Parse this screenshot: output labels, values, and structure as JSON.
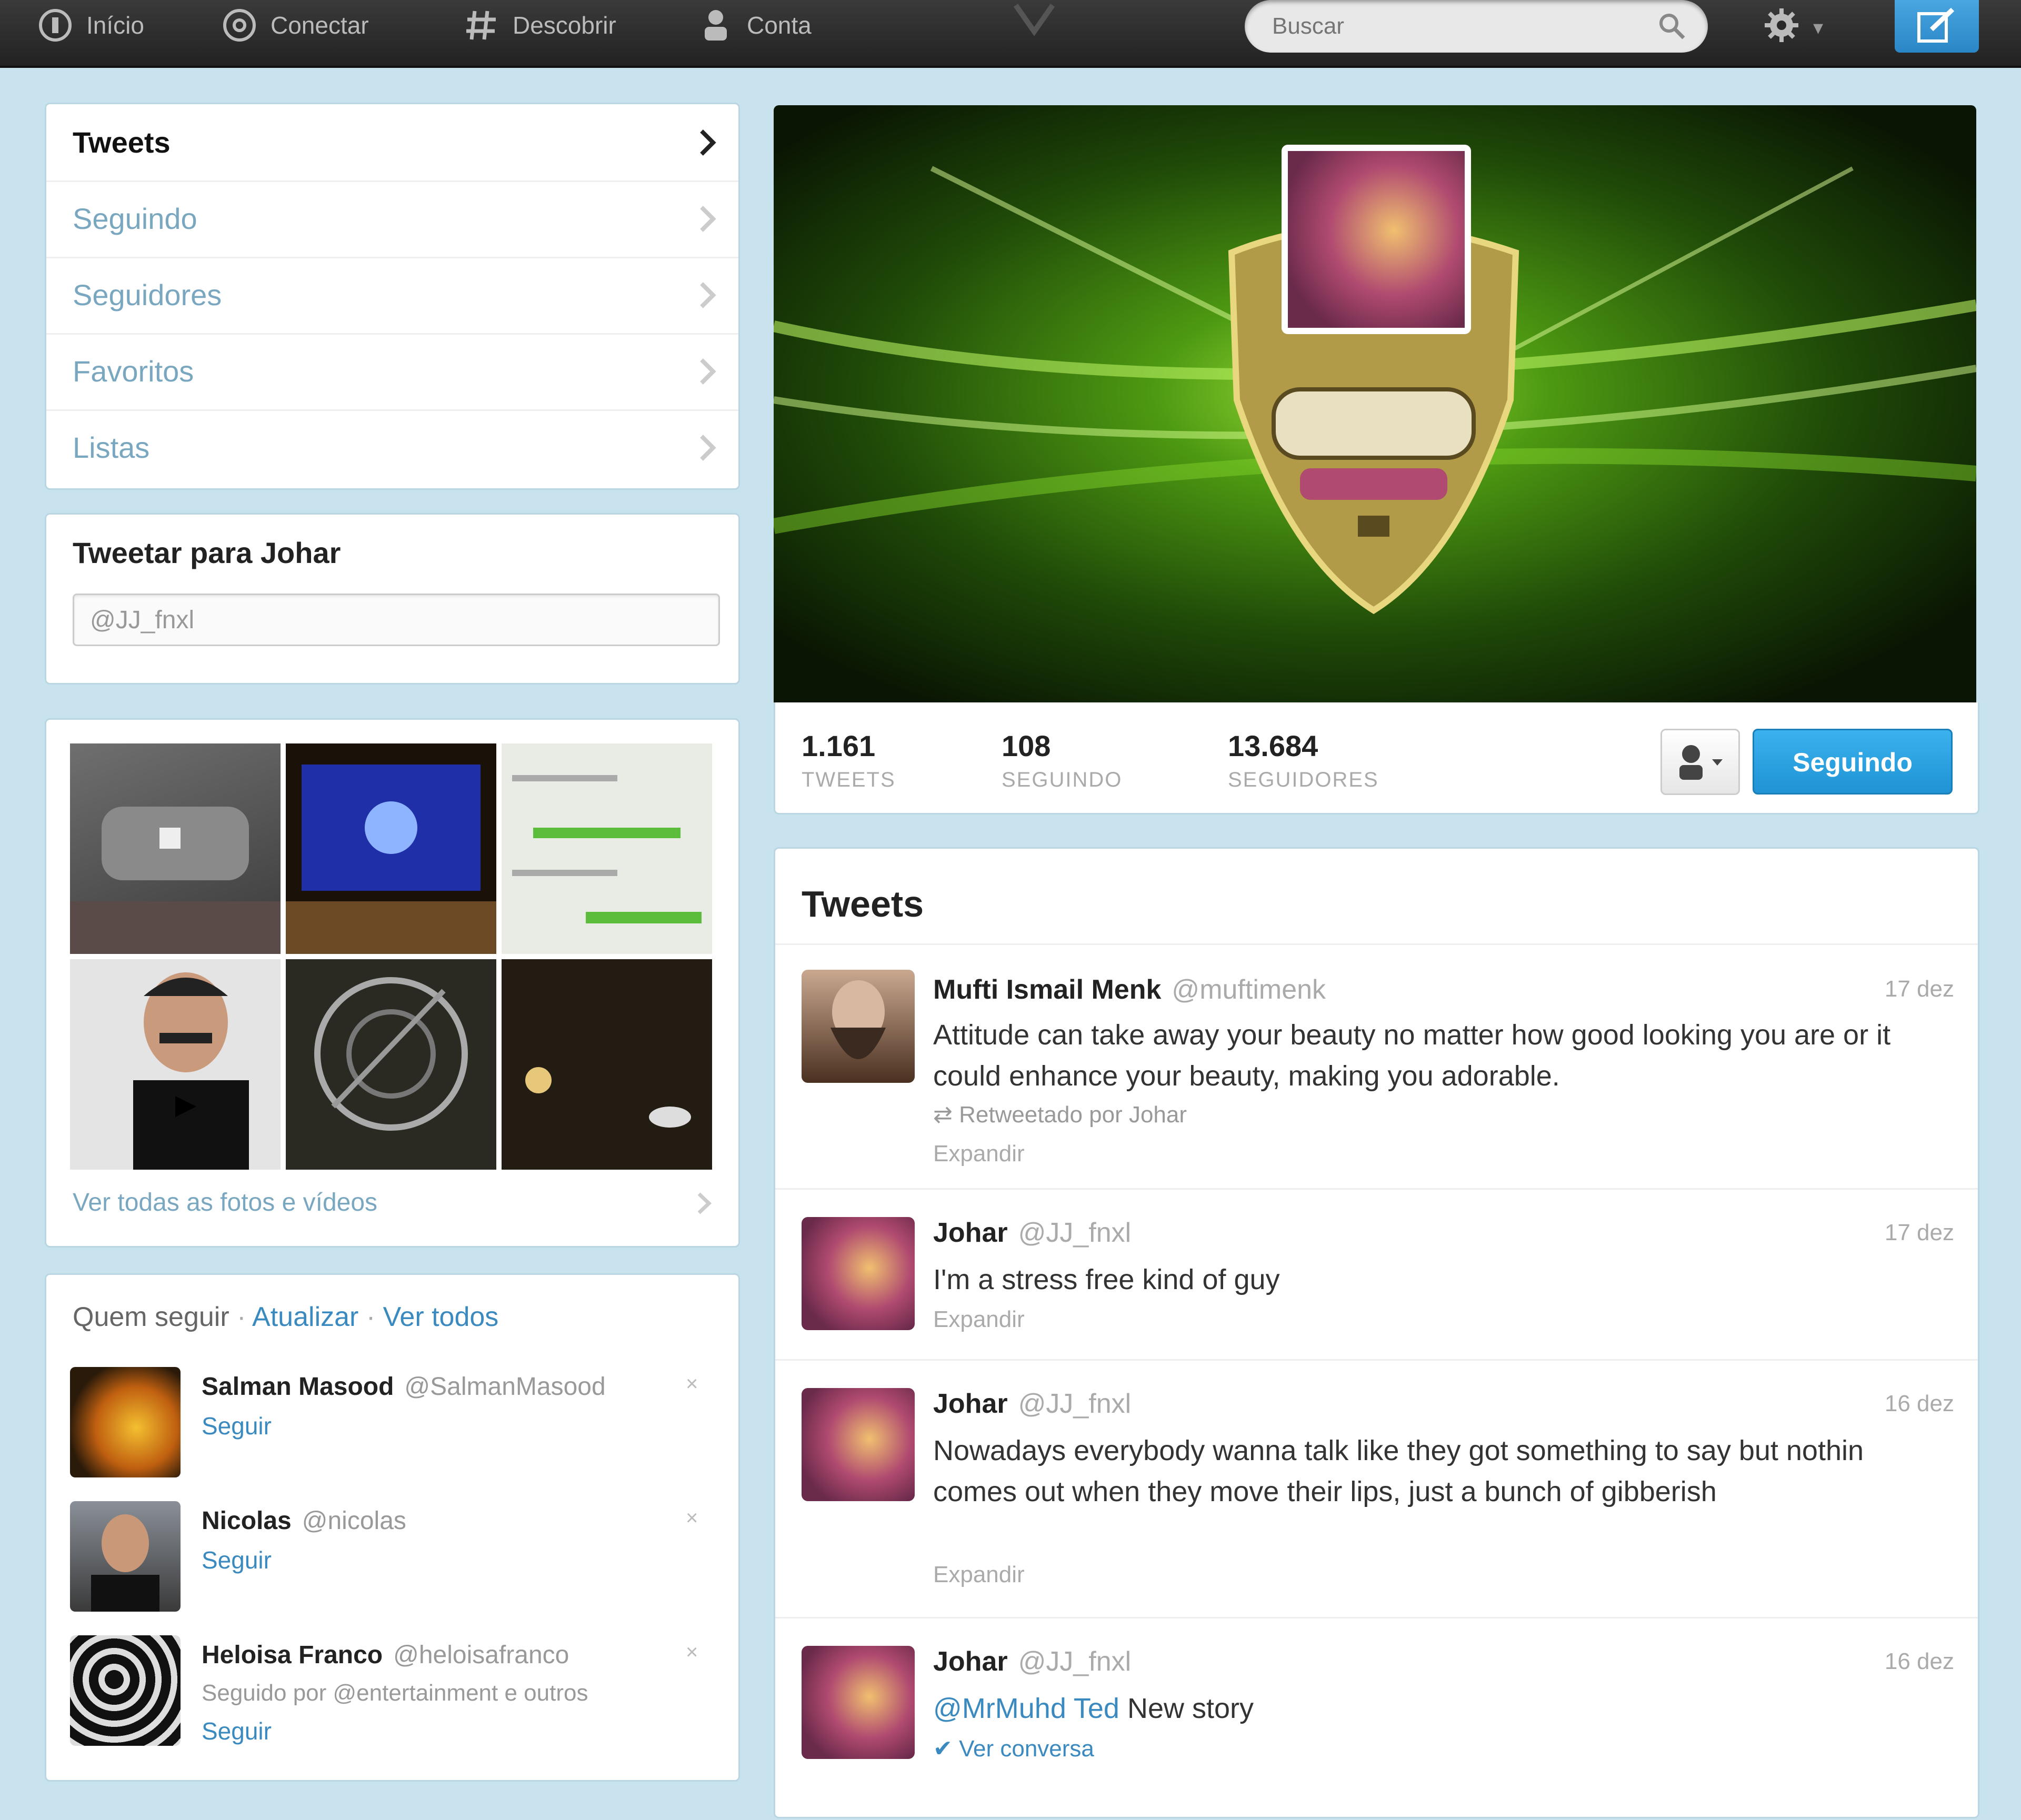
{
  "topnav": {
    "items": [
      {
        "label": "Início",
        "icon": "home-icon"
      },
      {
        "label": "Conectar",
        "icon": "at-icon"
      },
      {
        "label": "Descobrir",
        "icon": "hashtag-icon"
      },
      {
        "label": "Conta",
        "icon": "person-icon"
      }
    ],
    "search_placeholder": "Buscar"
  },
  "profile_nav": {
    "items": [
      "Tweets",
      "Seguindo",
      "Seguidores",
      "Favoritos",
      "Listas"
    ],
    "active": "Tweets"
  },
  "tweet_to": {
    "title": "Tweetar para Johar",
    "input_value": "@JJ_fnxl"
  },
  "media": {
    "link": "Ver todas as fotos e vídeos"
  },
  "who_to_follow": {
    "title": "Quem seguir",
    "refresh": "Atualizar",
    "view_all": "Ver todos",
    "users": [
      {
        "name": "Salman Masood",
        "handle": "@SalmanMasood",
        "action": "Seguir"
      },
      {
        "name": "Nicolas",
        "handle": "@nicolas",
        "action": "Seguir"
      },
      {
        "name": "Heloisa Franco",
        "handle": "@heloisafranco",
        "action": "Seguir",
        "note": "Seguido por @entertainment e outros"
      }
    ]
  },
  "stats": [
    {
      "value": "1.161",
      "label": "TWEETS"
    },
    {
      "value": "108",
      "label": "SEGUINDO"
    },
    {
      "value": "13.684",
      "label": "SEGUIDORES"
    }
  ],
  "follow_button": "Seguindo",
  "timeline": {
    "title": "Tweets",
    "tweets": [
      {
        "name": "Mufti Ismail Menk",
        "handle": "@muftimenk",
        "time": "17 dez",
        "text": "Attitude can take away your beauty no matter how good looking you are or it could enhance your beauty, making you adorable.",
        "meta": "Retweetado por Johar",
        "expand": "Expandir"
      },
      {
        "name": "Johar",
        "handle": "@JJ_fnxl",
        "time": "17 dez",
        "text": "I'm a stress free kind of guy",
        "expand": "Expandir"
      },
      {
        "name": "Johar",
        "handle": "@JJ_fnxl",
        "time": "16 dez",
        "text": "Nowadays everybody wanna talk like they got something to say but nothin comes out when they move their lips, just a bunch of gibberish",
        "expand": "Expandir"
      },
      {
        "name": "Johar",
        "handle": "@JJ_fnxl",
        "time": "16 dez",
        "mention": "@MrMuhd Ted",
        "text": " New story",
        "meta": "Ver conversa"
      }
    ]
  },
  "colors": {
    "background": "#c8e3ee",
    "link": "#3a8ac0",
    "follow_button": "#1f93d4",
    "header_green": "#3c7a10"
  }
}
